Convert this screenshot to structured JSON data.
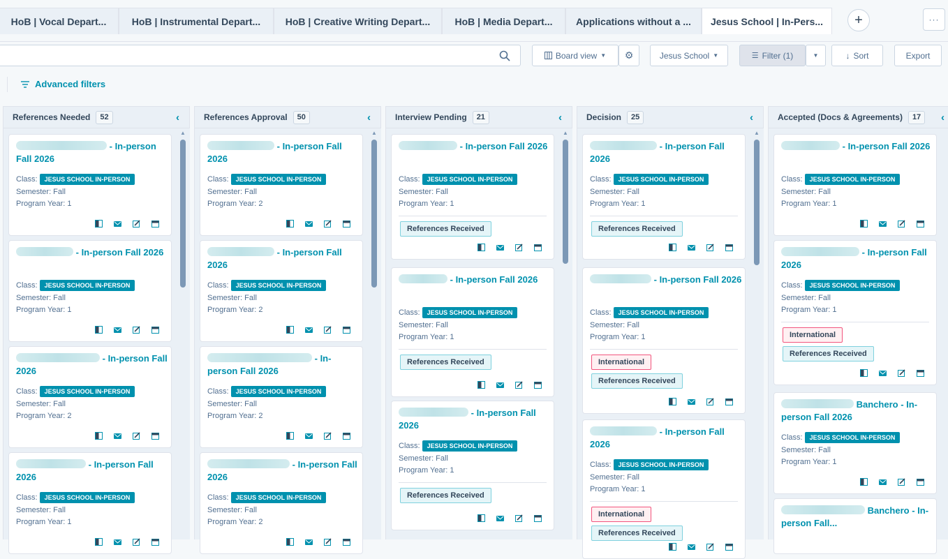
{
  "tabs": [
    "HoB | Vocal Depart...",
    "HoB | Instrumental Depart...",
    "HoB | Creative Writing Depart...",
    "HoB | Media Depart...",
    "Applications without a ...",
    "Jesus School | In-Pers..."
  ],
  "tab_add": "+",
  "tab_more": "···",
  "toolbar": {
    "board_view": "Board view",
    "school": "Jesus School",
    "filter": "Filter (1)",
    "sort": "Sort",
    "export": "Export",
    "advanced_filters": "Advanced filters"
  },
  "labels": {
    "class": "Class:",
    "chip": "JESUS SCHOOL IN-PERSON",
    "references_received": "References Received",
    "international": "International"
  },
  "columns": [
    {
      "name": "References Needed",
      "count": "52",
      "cards": [
        {
          "title": "- In-person Fall 2026",
          "semester": "Semester: Fall",
          "year": "Program Year: 1",
          "tags": []
        },
        {
          "title": "- In-person Fall 2026",
          "semester": "Semester: Fall",
          "year": "Program Year: 1",
          "tags": []
        },
        {
          "title": "- In-person Fall 2026",
          "semester": "Semester: Fall",
          "year": "Program Year: 2",
          "tags": []
        },
        {
          "title": "- In-person Fall 2026",
          "semester": "Semester: Fall",
          "year": "Program Year: 1",
          "tags": []
        }
      ]
    },
    {
      "name": "References Approval",
      "count": "50",
      "cards": [
        {
          "title": "- In-person Fall 2026",
          "semester": "Semester: Fall",
          "year": "Program Year: 2",
          "tags": []
        },
        {
          "title": "- In-person Fall 2026",
          "semester": "Semester: Fall",
          "year": "Program Year: 2",
          "tags": []
        },
        {
          "title": "- In-person Fall 2026",
          "semester": "Semester: Fall",
          "year": "Program Year: 2",
          "tags": []
        },
        {
          "title": "- In-person Fall 2026",
          "semester": "Semester: Fall",
          "year": "Program Year: 2",
          "tags": []
        }
      ]
    },
    {
      "name": "Interview Pending",
      "count": "21",
      "cards": [
        {
          "title": "- In-person Fall 2026",
          "semester": "Semester: Fall",
          "year": "Program Year: 1",
          "tags": [
            "References Received"
          ]
        },
        {
          "title": "- In-person Fall 2026",
          "semester": "Semester: Fall",
          "year": "Program Year: 1",
          "tags": [
            "References Received"
          ]
        },
        {
          "title": "- In-person Fall 2026",
          "semester": "Semester: Fall",
          "year": "Program Year: 1",
          "tags": [
            "References Received"
          ]
        }
      ]
    },
    {
      "name": "Decision",
      "count": "25",
      "cards": [
        {
          "title": "- In-person Fall 2026",
          "semester": "Semester: Fall",
          "year": "Program Year: 1",
          "tags": [
            "References Received"
          ]
        },
        {
          "title": "- In-person Fall 2026",
          "semester": "Semester: Fall",
          "year": "Program Year: 1",
          "tags": [
            "International",
            "References Received"
          ]
        },
        {
          "title": "- In-person Fall 2026",
          "semester": "Semester: Fall",
          "year": "Program Year: 1",
          "tags": [
            "International",
            "References Received"
          ]
        }
      ]
    },
    {
      "name": "Accepted (Docs & Agreements)",
      "count": "17",
      "cards": [
        {
          "title": "- In-person Fall 2026",
          "semester": "Semester: Fall",
          "year": "Program Year: 1",
          "tags": []
        },
        {
          "title": "- In-person Fall 2026",
          "semester": "Semester: Fall",
          "year": "Program Year: 1",
          "tags": [
            "International",
            "References Received"
          ]
        },
        {
          "title": "Banchero - In-person Fall 2026",
          "semester": "Semester: Fall",
          "year": "Program Year: 1",
          "tags": []
        },
        {
          "title": "Banchero - In-person Fall...",
          "semester": "",
          "year": "",
          "tags": []
        }
      ]
    }
  ]
}
